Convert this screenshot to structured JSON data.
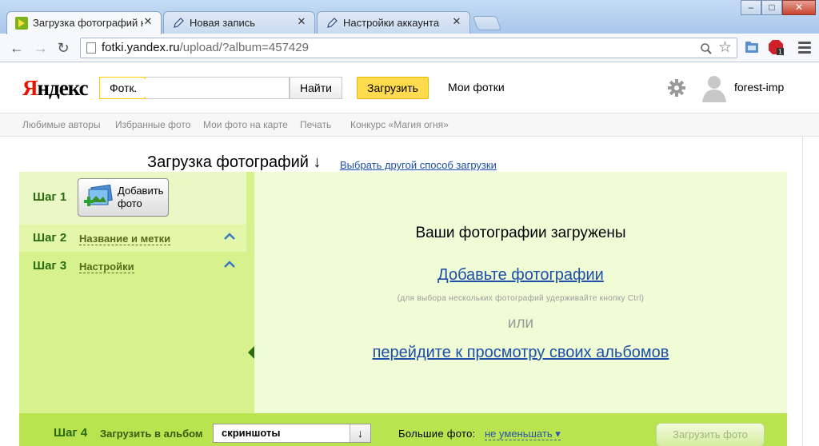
{
  "browser": {
    "tabs": [
      {
        "label": "Загрузка фотографий на",
        "active": true
      },
      {
        "label": "Новая запись",
        "active": false
      },
      {
        "label": "Настройки аккаунта",
        "active": false
      }
    ],
    "url_host": "fotki.yandex.ru",
    "url_path": "/upload/?album=457429",
    "window_buttons": [
      "–",
      "□",
      "✕"
    ]
  },
  "header": {
    "logo_first": "Я",
    "logo_rest": "ндекс",
    "service": "Фотки",
    "search_placeholder": "",
    "search_button": "Найти",
    "upload_button": "Загрузить",
    "my_photos": "Мои фотки",
    "username": "forest-imp"
  },
  "subnav": [
    "Любимые авторы",
    "Избранные фото",
    "Мои фото на карте",
    "Печать",
    "Конкурс «Магия огня»"
  ],
  "upload": {
    "heading": "Загрузка фотографий ↓",
    "other_method": "Выбрать другой способ загрузки"
  },
  "steps": {
    "step1_label": "Шаг 1",
    "add_photo_line1": "Добавить",
    "add_photo_line2": "фото",
    "step2_label": "Шаг 2",
    "step2_link": "Название и метки",
    "step3_label": "Шаг 3",
    "step3_link": "Настройки"
  },
  "content": {
    "uploaded_message": "Ваши фотографии загружены",
    "add_photos_link": "Добавьте фотографии",
    "hint": "(для выбора нескольких фотографий удерживайте кнопку Ctrl)",
    "or": "или",
    "albums_link": "перейдите к просмотру своих альбомов"
  },
  "bottom": {
    "step4_label": "Шаг 4",
    "album_label": "Загрузить в альбом",
    "album_value": "скриншоты",
    "album_arrow": "↓",
    "big_photos_label": "Большие фото:",
    "big_photos_value": "не уменьшать ▾",
    "submit_button": "Загрузить фото"
  },
  "colors": {
    "panel_green": "#d7f28c",
    "content_green": "#effcd6",
    "bottom_green": "#b9e34f",
    "yandex_yellow": "#ffdb4d",
    "link_blue": "#1e4fa8"
  }
}
